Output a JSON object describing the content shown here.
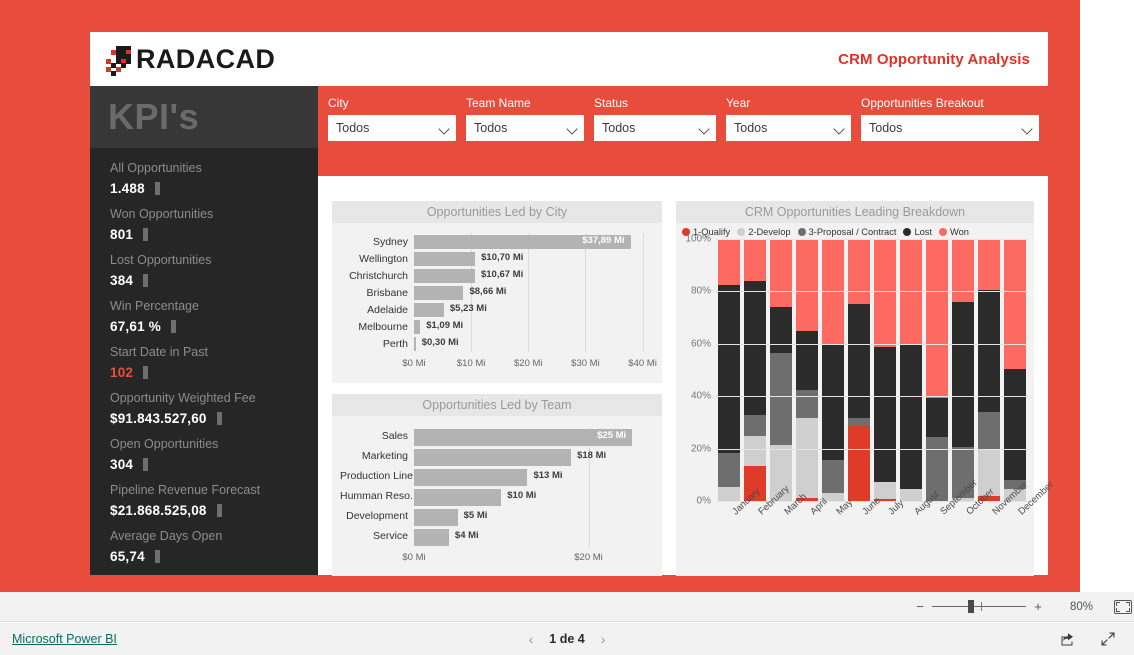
{
  "header": {
    "logo_text": "RADACAD",
    "title": "CRM Opportunity Analysis",
    "accent_color": "#e03127"
  },
  "kpi_panel": {
    "heading": "KPI's",
    "items": [
      {
        "label": "All Opportunities",
        "value": "1.488",
        "accent": false
      },
      {
        "label": "Won Opportunities",
        "value": "801",
        "accent": false
      },
      {
        "label": "Lost Opportunities",
        "value": "384",
        "accent": false
      },
      {
        "label": "Win Percentage",
        "value": "67,61 %",
        "accent": false
      },
      {
        "label": "Start Date in Past",
        "value": "102",
        "accent": true
      },
      {
        "label": "Opportunity Weighted Fee",
        "value": "$91.843.527,60",
        "accent": false
      },
      {
        "label": "Open Opportunities",
        "value": "304",
        "accent": false
      },
      {
        "label": "Pipeline Revenue Forecast",
        "value": "$21.868.525,08",
        "accent": false
      },
      {
        "label": "Average Days Open",
        "value": "65,74",
        "accent": false
      }
    ]
  },
  "filters": [
    {
      "label": "City",
      "value": "Todos"
    },
    {
      "label": "Team Name",
      "value": "Todos"
    },
    {
      "label": "Status",
      "value": "Todos"
    },
    {
      "label": "Year",
      "value": "Todos"
    },
    {
      "label": "Opportunities Breakout",
      "value": "Todos"
    }
  ],
  "chart_data": [
    {
      "type": "bar",
      "orientation": "horizontal",
      "title": "Opportunities Led by City",
      "categories": [
        "Sydney",
        "Wellington",
        "Christchurch",
        "Brisbane",
        "Adelaide",
        "Melbourne",
        "Perth"
      ],
      "values": [
        37.89,
        10.7,
        10.67,
        8.66,
        5.23,
        1.09,
        0.3
      ],
      "value_labels": [
        "$37,89 Mi",
        "$10,70 Mi",
        "$10,67 Mi",
        "$8,66 Mi",
        "$5,23 Mi",
        "$1,09 Mi",
        "$0,30 Mi"
      ],
      "label_inside": [
        true,
        false,
        false,
        false,
        false,
        false,
        false
      ],
      "xlabel": "",
      "ylabel": "",
      "xlim": [
        0,
        42
      ],
      "xticks": [
        0,
        10,
        20,
        30,
        40
      ],
      "xtick_labels": [
        "$0 Mi",
        "$10 Mi",
        "$20 Mi",
        "$30 Mi",
        "$40 Mi"
      ],
      "grid": true,
      "bar_color": "#b3b3b3"
    },
    {
      "type": "bar",
      "orientation": "horizontal",
      "title": "Opportunities Led by Team",
      "categories": [
        "Sales",
        "Marketing",
        "Production Line",
        "Humman Reso...",
        "Development",
        "Service"
      ],
      "values": [
        25,
        18,
        13,
        10,
        5,
        4
      ],
      "value_labels": [
        "$25 Mi",
        "$18 Mi",
        "$13 Mi",
        "$10 Mi",
        "$5 Mi",
        "$4 Mi"
      ],
      "label_inside": [
        true,
        false,
        false,
        false,
        false,
        false
      ],
      "xlabel": "",
      "ylabel": "",
      "xlim": [
        0,
        27.5
      ],
      "xticks": [
        0,
        20
      ],
      "xtick_labels": [
        "$0 Mi",
        "$20 Mi"
      ],
      "grid": true,
      "bar_color": "#b3b3b3"
    },
    {
      "type": "bar",
      "stacked": true,
      "normalized": true,
      "title": "CRM Opportunities Leading Breakdown",
      "categories": [
        "January",
        "February",
        "March",
        "April",
        "May",
        "June",
        "July",
        "August",
        "September",
        "October",
        "November",
        "December"
      ],
      "ylabel": "",
      "xlabel": "",
      "ylim": [
        0,
        100
      ],
      "yticks": [
        0,
        20,
        40,
        60,
        80,
        100
      ],
      "ytick_labels": [
        "0%",
        "20%",
        "40%",
        "60%",
        "80%",
        "100%"
      ],
      "grid": true,
      "legend_position": "top",
      "series": [
        {
          "name": "1-Qualify",
          "color": "#e03a29",
          "values": [
            0,
            13.5,
            0,
            1.0,
            0,
            28.8,
            0.8,
            0,
            0,
            0,
            2.0,
            0
          ]
        },
        {
          "name": "2-Develop",
          "color": "#cfcfcf",
          "values": [
            5.5,
            11.5,
            21.5,
            30.5,
            3.0,
            0,
            6.5,
            4.5,
            0,
            1.0,
            17.5,
            4.5
          ]
        },
        {
          "name": "3-Proposal / Contract",
          "color": "#6e6e6e",
          "values": [
            13.0,
            8.0,
            35.0,
            11.0,
            12.5,
            3.0,
            0,
            0,
            24.5,
            19.5,
            14.5,
            3.5
          ]
        },
        {
          "name": "Lost",
          "color": "#2b2b2b",
          "values": [
            64.0,
            51.0,
            17.5,
            22.5,
            44.0,
            43.5,
            51.5,
            55.5,
            15.0,
            55.5,
            46.5,
            42.5
          ]
        },
        {
          "name": "Won",
          "color": "#fc6a62",
          "values": [
            17.5,
            16.0,
            26.0,
            35.0,
            40.5,
            24.7,
            41.2,
            40.0,
            60.5,
            24.0,
            19.5,
            49.5
          ]
        }
      ]
    }
  ],
  "zoom_bar": {
    "minus": "−",
    "plus": "+",
    "percent": "80%",
    "fit_icon": "fit-to-page-icon"
  },
  "status_bar": {
    "brand_link": "Microsoft Power BI",
    "prev_arrow": "‹",
    "page_text": "1 de 4",
    "next_arrow": "›",
    "share_icon": "share-icon",
    "fullscreen_icon": "fullscreen-icon"
  }
}
